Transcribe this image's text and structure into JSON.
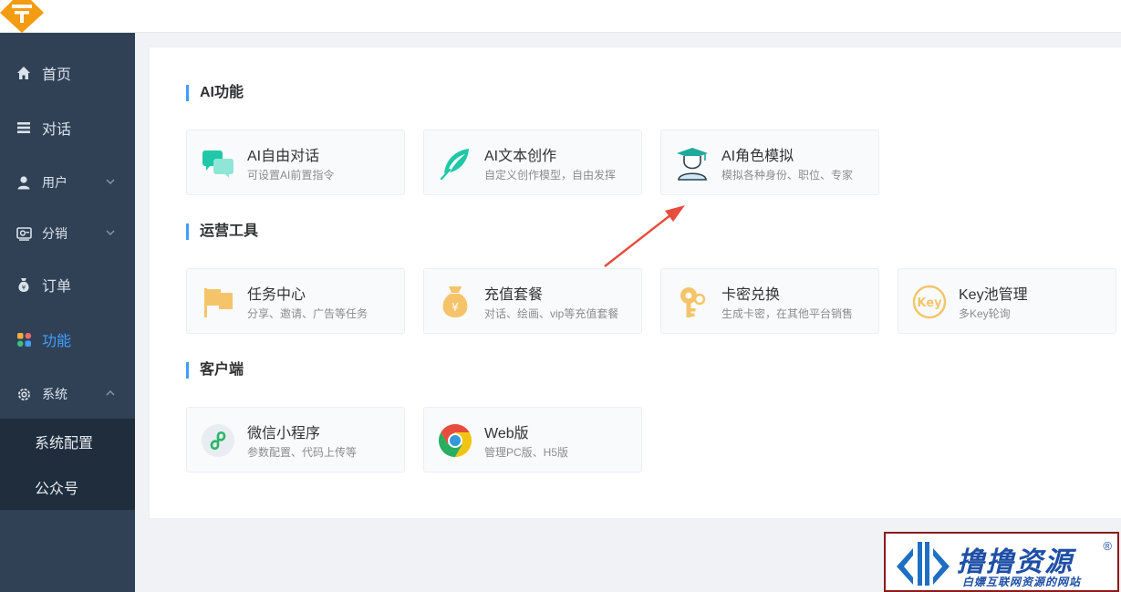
{
  "sidebar": {
    "items": [
      {
        "label": "首页",
        "icon": "home-icon"
      },
      {
        "label": "对话",
        "icon": "menu-list-icon"
      },
      {
        "label": "用户",
        "icon": "user-icon"
      },
      {
        "label": "分销",
        "icon": "distribution-icon"
      },
      {
        "label": "订单",
        "icon": "money-bag-icon"
      },
      {
        "label": "功能",
        "icon": "apps-grid-icon"
      },
      {
        "label": "系统",
        "icon": "gear-icon"
      }
    ],
    "active": "功能",
    "submenu": [
      {
        "label": "系统配置"
      },
      {
        "label": "公众号"
      }
    ]
  },
  "sections": [
    {
      "title": "AI功能",
      "cards": [
        {
          "title": "AI自由对话",
          "desc": "可设置AI前置指令",
          "icon": "chat-bubbles-icon"
        },
        {
          "title": "AI文本创作",
          "desc": "自定义创作模型，自由发挥",
          "icon": "feather-icon"
        },
        {
          "title": "AI角色模拟",
          "desc": "模拟各种身份、职位、专家",
          "icon": "graduate-icon"
        }
      ]
    },
    {
      "title": "运营工具",
      "cards": [
        {
          "title": "任务中心",
          "desc": "分享、邀请、广告等任务",
          "icon": "flag-icon"
        },
        {
          "title": "充值套餐",
          "desc": "对话、绘画、vip等充值套餐",
          "icon": "yuan-bag-icon"
        },
        {
          "title": "卡密兑换",
          "desc": "生成卡密，在其他平台销售",
          "icon": "key-icon"
        },
        {
          "title": "Key池管理",
          "desc": "多Key轮询",
          "icon": "key-badge-icon",
          "badge": "Key"
        }
      ]
    },
    {
      "title": "客户端",
      "cards": [
        {
          "title": "微信小程序",
          "desc": "参数配置、代码上传等",
          "icon": "mini-program-icon"
        },
        {
          "title": "Web版",
          "desc": "管理PC版、H5版",
          "icon": "chrome-icon"
        }
      ]
    }
  ],
  "watermark": {
    "title": "撸撸资源",
    "reg": "®",
    "subtitle": "白嫖互联网资源的网站"
  },
  "colors": {
    "sidebar_bg": "#304156",
    "submenu_bg": "#1f2d3d",
    "accent": "#409eff",
    "logo": "#f39c12",
    "annotation_arrow": "#e74c3c"
  }
}
